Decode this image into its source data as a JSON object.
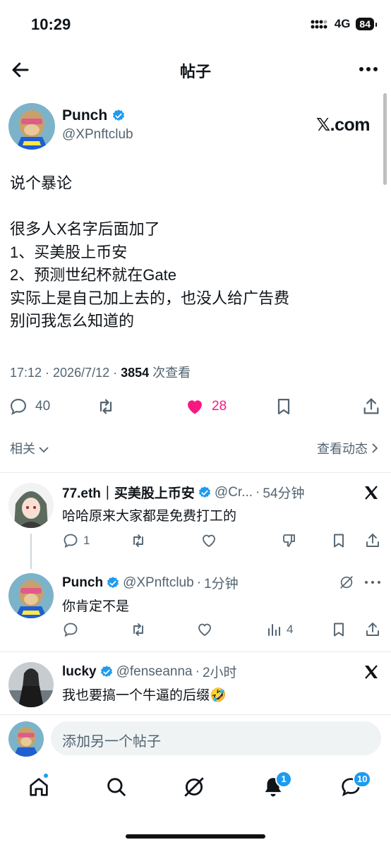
{
  "status": {
    "time": "10:29",
    "network": "4G",
    "battery": "84"
  },
  "header": {
    "title": "帖子",
    "back_icon": "back-arrow-icon",
    "more_icon": "more-icon"
  },
  "post": {
    "author_name": "Punch",
    "author_handle": "@XPnftclub",
    "source": "𝕏.com",
    "lines": [
      "说个暴论",
      "",
      "很多人X名字后面加了",
      "1、买美股上币安",
      "2、预测世纪杯就在Gate",
      "实际上是自己加上去的，也没人给广告费",
      "别问我怎么知道的"
    ],
    "meta_prefix": "17:12 · 2026/7/12 · ",
    "views": "3854",
    "views_label": " 次查看",
    "replies": "40",
    "likes": "28",
    "related": "相关",
    "view_activity": "查看动态"
  },
  "replies": [
    {
      "name": "77.eth｜买美股上币安",
      "handle": "@Cr...",
      "time": "54分钟",
      "text": "哈哈原来大家都是免费打工的",
      "reply_count": "1"
    },
    {
      "name": "Punch",
      "handle": "@XPnftclub",
      "time": "1分钟",
      "text": "你肯定不是",
      "views": "4"
    },
    {
      "name": "lucky",
      "handle": "@fenseanna",
      "time": "2小时",
      "text": "我也要搞一个牛逼的后缀🤣"
    }
  ],
  "compose": {
    "placeholder": "添加另一个帖子"
  },
  "tabs": {
    "notifications_badge": "1",
    "messages_badge": "10"
  },
  "colors": {
    "accent": "#1d9bf0",
    "like": "#f91880",
    "muted": "#536471"
  }
}
